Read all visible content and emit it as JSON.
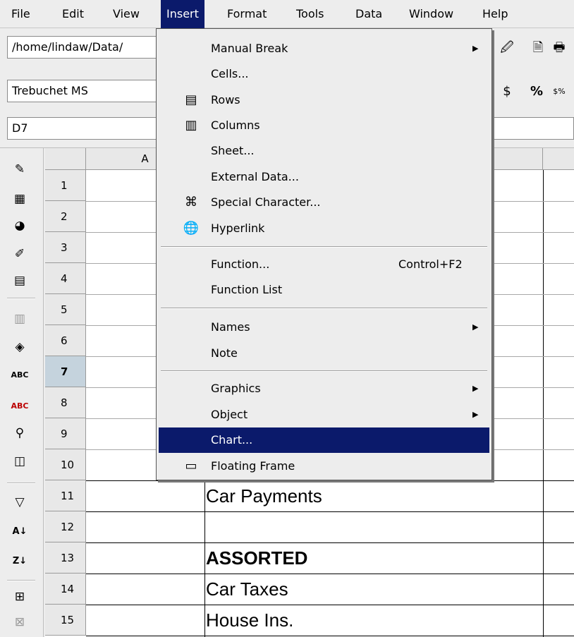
{
  "menubar": [
    "File",
    "Edit",
    "View",
    "Insert",
    "Format",
    "Tools",
    "Data",
    "Window",
    "Help"
  ],
  "toolbar": {
    "path": "/home/lindaw/Data/",
    "font_name": "Trebuchet MS",
    "name_box": "D7"
  },
  "grid": {
    "col_a": "A",
    "rows": [
      "1",
      "2",
      "3",
      "4",
      "5",
      "6",
      "7",
      "8",
      "9",
      "10",
      "11",
      "12",
      "13",
      "14",
      "15"
    ],
    "selected_row": "7",
    "cells": {
      "r11": "Car Payments",
      "r13": "ASSORTED",
      "r14": "Car Taxes",
      "r15": "House Ins."
    }
  },
  "insert_menu": {
    "manual_break": "Manual Break",
    "cells": "Cells...",
    "rows": "Rows",
    "columns": "Columns",
    "sheet": "Sheet...",
    "external_data": "External Data...",
    "special_character": "Special Character...",
    "hyperlink": "Hyperlink",
    "function": "Function...",
    "function_shortcut": "Control+F2",
    "function_list": "Function List",
    "names": "Names",
    "note": "Note",
    "graphics": "Graphics",
    "object": "Object",
    "chart": "Chart...",
    "floating_frame": "Floating Frame"
  },
  "colors": {
    "highlight": "#0b1a6b",
    "selected_row": "#c5d3dd"
  }
}
